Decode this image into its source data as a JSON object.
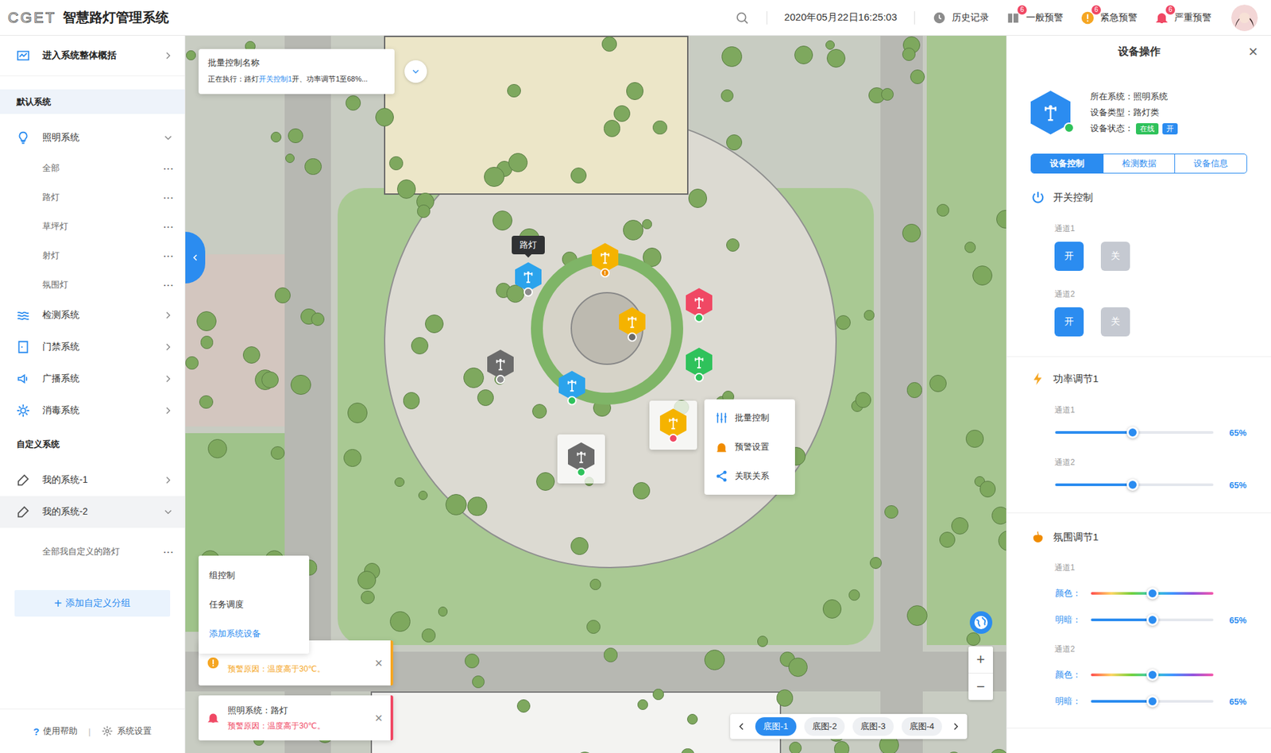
{
  "header": {
    "logo_mark": "CGET",
    "title": "智慧路灯管理系统",
    "datetime": "2020年05月22日16:25:03",
    "nav": [
      {
        "label": "历史记录",
        "kind": "history"
      },
      {
        "label": "一般预警",
        "kind": "general",
        "badge": "6",
        "color": "#8c8c8c"
      },
      {
        "label": "紧急预警",
        "kind": "urgent",
        "badge": "6",
        "color": "#f5a623"
      },
      {
        "label": "严重预警",
        "kind": "severe",
        "badge": "6",
        "color": "#f04864"
      }
    ]
  },
  "sidebar": {
    "overview": "进入系统整体概括",
    "sections": [
      {
        "title": "默认系统",
        "selected": true,
        "groups": [
          {
            "label": "照明系统",
            "expanded": true,
            "selected": false,
            "children": [
              {
                "label": "全部",
                "more": "···"
              },
              {
                "label": "路灯",
                "more": "···"
              },
              {
                "label": "草坪灯",
                "more": "···"
              },
              {
                "label": "射灯",
                "more": "···"
              },
              {
                "label": "氛围灯",
                "more": "···"
              }
            ]
          },
          {
            "label": "检测系统",
            "expanded": false,
            "selected": false,
            "children": []
          },
          {
            "label": "门禁系统",
            "expanded": false,
            "selected": false,
            "children": []
          },
          {
            "label": "广播系统",
            "expanded": false,
            "selected": false,
            "children": []
          },
          {
            "label": "消毒系统",
            "expanded": false,
            "selected": false,
            "children": []
          }
        ]
      },
      {
        "title": "自定义系统",
        "selected": false,
        "groups": [
          {
            "label": "我的系统-1",
            "expanded": false,
            "selected": false,
            "children": []
          },
          {
            "label": "我的系统-2",
            "expanded": true,
            "selected": true,
            "children": [
              {
                "label": "全部我自定义的路灯",
                "more": "···"
              }
            ]
          }
        ]
      }
    ],
    "add_button": {
      "icon": "+",
      "label": "添加自定义分组"
    },
    "footer": {
      "help_icon": "?",
      "help": "使用帮助",
      "separator": "|",
      "settings": "系统设置"
    }
  },
  "map": {
    "batch": {
      "title": "批量控制名称",
      "status": [
        {
          "text": "正在执行：路灯",
          "link": false
        },
        {
          "text": "开关控制1",
          "link": true
        },
        {
          "text": "开、功率调节1至68%...",
          "link": false
        }
      ]
    },
    "markers": [
      {
        "color": "#2ba3ec",
        "dot": "#8c8c8c",
        "selected": false,
        "tooltip": "路灯"
      },
      {
        "color": "#f5b300",
        "dot": "#f08c00",
        "selected": false,
        "mark": "!"
      },
      {
        "color": "#f04864",
        "dot": "#2fc25b",
        "selected": false
      },
      {
        "color": "#f5b300",
        "dot": "#6b6b6b",
        "selected": false
      },
      {
        "color": "#6b6b6b",
        "dot": "#8c8c8c",
        "selected": false
      },
      {
        "color": "#2fc25b",
        "dot": "#2fc25b",
        "selected": false
      },
      {
        "color": "#2ba3ec",
        "dot": "#2fc25b",
        "selected": false
      },
      {
        "color": "#f5b300",
        "dot": "#f04864",
        "selected": true
      },
      {
        "color": "#6b6b6b",
        "dot": "#2fc25b",
        "selected": true
      }
    ],
    "context_menu": [
      {
        "label": "批量控制"
      },
      {
        "label": "预警设置"
      },
      {
        "label": "关联关系"
      }
    ],
    "quick_menu": [
      {
        "label": "组控制",
        "selected": false
      },
      {
        "label": "任务调度",
        "selected": false
      },
      {
        "label": "添加系统设备",
        "selected": true
      }
    ],
    "alerts": [
      {
        "kind": "urgent",
        "reason": "预警原因：温度高于30℃。",
        "close": "×",
        "color": "#f5a623"
      },
      {
        "kind": "severe",
        "title": "照明系统：路灯",
        "reason": "预警原因：温度高于30℃。",
        "close": "×",
        "color": "#f04864"
      }
    ],
    "zoom": {
      "in": "+",
      "out": "−"
    },
    "layers": [
      {
        "label": "底图-1",
        "selected": true
      },
      {
        "label": "底图-2",
        "selected": false
      },
      {
        "label": "底图-3",
        "selected": false
      },
      {
        "label": "底图-4",
        "selected": false
      }
    ]
  },
  "panel": {
    "title": "设备操作",
    "close": "×",
    "online": true,
    "info": [
      "所在系统：照明系统",
      "设备类型：路灯类"
    ],
    "status_label": "设备状态：",
    "tags": [
      {
        "label": "在线",
        "color": "#2fc25b"
      },
      {
        "label": "开",
        "color": "#2b8cf0"
      }
    ],
    "tabs": [
      {
        "label": "设备控制",
        "selected": true
      },
      {
        "label": "检测数据",
        "selected": false
      },
      {
        "label": "设备信息",
        "selected": false
      }
    ],
    "sections": [
      {
        "title": "开关控制",
        "kind": "switch",
        "channels": [
          {
            "label": "通道1",
            "buttons": [
              {
                "label": "开",
                "selected": true
              },
              {
                "label": "关",
                "selected": false
              }
            ]
          },
          {
            "label": "通道2",
            "buttons": [
              {
                "label": "开",
                "selected": true
              },
              {
                "label": "关",
                "selected": false
              }
            ]
          }
        ]
      },
      {
        "title": "功率调节1",
        "kind": "power",
        "channels": [
          {
            "label": "通道1",
            "level": 0.49,
            "reading": "65%"
          },
          {
            "label": "通道2",
            "level": 0.49,
            "reading": "65%"
          }
        ]
      },
      {
        "title": "氛围调节1",
        "kind": "ambient",
        "channels": [
          {
            "label": "通道1",
            "rows": [
              {
                "label": "颜色：",
                "kind": "color",
                "level": 0.5
              },
              {
                "label": "明暗：",
                "kind": "brightness",
                "level": 0.5,
                "reading": "65%"
              }
            ]
          },
          {
            "label": "通道2",
            "rows": [
              {
                "label": "颜色：",
                "kind": "color",
                "level": 0.5
              },
              {
                "label": "明暗：",
                "kind": "brightness",
                "level": 0.5,
                "reading": "65%"
              }
            ]
          }
        ]
      }
    ]
  }
}
